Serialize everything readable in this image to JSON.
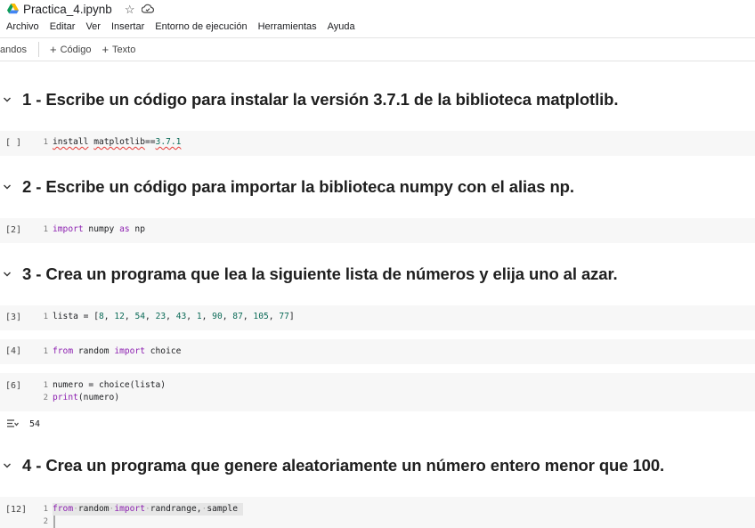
{
  "header": {
    "title": "Practica_4.ipynb",
    "star_icon": "☆"
  },
  "menu": [
    "Archivo",
    "Editar",
    "Ver",
    "Insertar",
    "Entorno de ejecución",
    "Herramientas",
    "Ayuda"
  ],
  "toolbar": {
    "commands_label": "andos",
    "add_code_label": "Código",
    "add_text_label": "Texto"
  },
  "sections": [
    {
      "title": "1 - Escribe un código para instalar la versión 3.7.1 de la biblioteca matplotlib."
    },
    {
      "title": "2 - Escribe un código para importar la biblioteca numpy con el alias np."
    },
    {
      "title": "3 - Crea un programa que lea la siguiente lista de números y elija uno al azar."
    },
    {
      "title": "4 - Crea un programa que genere aleatoriamente un número entero menor que 100."
    }
  ],
  "cells": {
    "c1": {
      "exec": "[ ]",
      "l1": "1",
      "t1": "install",
      "t2": "matplotlib",
      "t3": "==",
      "t4": "3.7.1"
    },
    "c2": {
      "exec": "[2]",
      "l1": "1",
      "t1": "import",
      "t2": " numpy ",
      "t3": "as",
      "t4": " np"
    },
    "c3": {
      "exec": "[3]",
      "l1": "1",
      "t1": "lista = [",
      "n1": "8",
      "n2": "12",
      "n3": "54",
      "n4": "23",
      "n5": "43",
      "n6": "1",
      "n7": "90",
      "n8": "87",
      "n9": "105",
      "n10": "77",
      "sep": ", ",
      "close": "]"
    },
    "c4": {
      "exec": "[4]",
      "l1": "1",
      "t1": "from",
      "t2": " random ",
      "t3": "import",
      "t4": " choice"
    },
    "c5": {
      "exec": "[6]",
      "l1": "1",
      "l2": "2",
      "t1": "numero = choice(lista)",
      "t2": "print",
      "t3": "(numero)"
    },
    "c6": {
      "exec": "[12]",
      "l1": "1",
      "l2": "2",
      "t1": "from",
      "t2": "random",
      "t3": "import",
      "t4": "randrange,",
      "t5": "sample",
      "dot": "·"
    }
  },
  "output": {
    "value": "54"
  },
  "colors": {
    "keyword": "#8c1fb0",
    "number": "#0c6b58",
    "cell_bg": "#f7f7f7"
  }
}
